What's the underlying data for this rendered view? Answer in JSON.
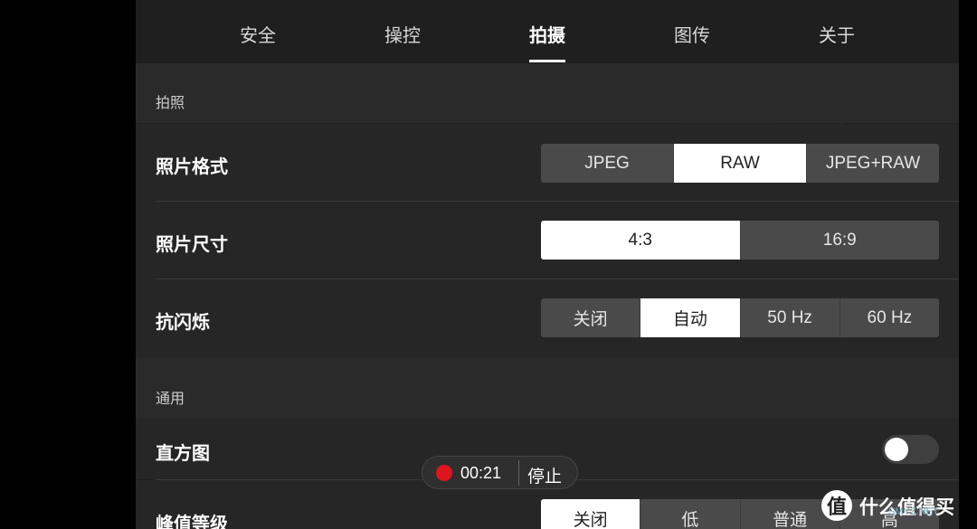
{
  "tabs": [
    {
      "label": "安全"
    },
    {
      "label": "操控"
    },
    {
      "label": "拍摄"
    },
    {
      "label": "图传"
    },
    {
      "label": "关于"
    }
  ],
  "active_tab": "拍摄",
  "sections": {
    "photo": {
      "title": "拍照"
    },
    "general": {
      "title": "通用"
    }
  },
  "settings": {
    "photo_format": {
      "label": "照片格式",
      "options": [
        "JPEG",
        "RAW",
        "JPEG+RAW"
      ],
      "selected": "RAW"
    },
    "photo_size": {
      "label": "照片尺寸",
      "options": [
        "4:3",
        "16:9"
      ],
      "selected": "4:3"
    },
    "anti_flicker": {
      "label": "抗闪烁",
      "options": [
        "关闭",
        "自动",
        "50 Hz",
        "60 Hz"
      ],
      "selected": "自动"
    },
    "histogram": {
      "label": "直方图",
      "enabled": false
    },
    "peaking": {
      "label": "峰值等级",
      "options": [
        "关闭",
        "低",
        "普通",
        "高"
      ],
      "selected": "关闭"
    }
  },
  "recording": {
    "time": "00:21",
    "stop_label": "停止",
    "dot_color": "#e0141e"
  },
  "watermark": {
    "logo_char": "值",
    "text": "什么值得买",
    "url": "SMYZ.NET"
  }
}
